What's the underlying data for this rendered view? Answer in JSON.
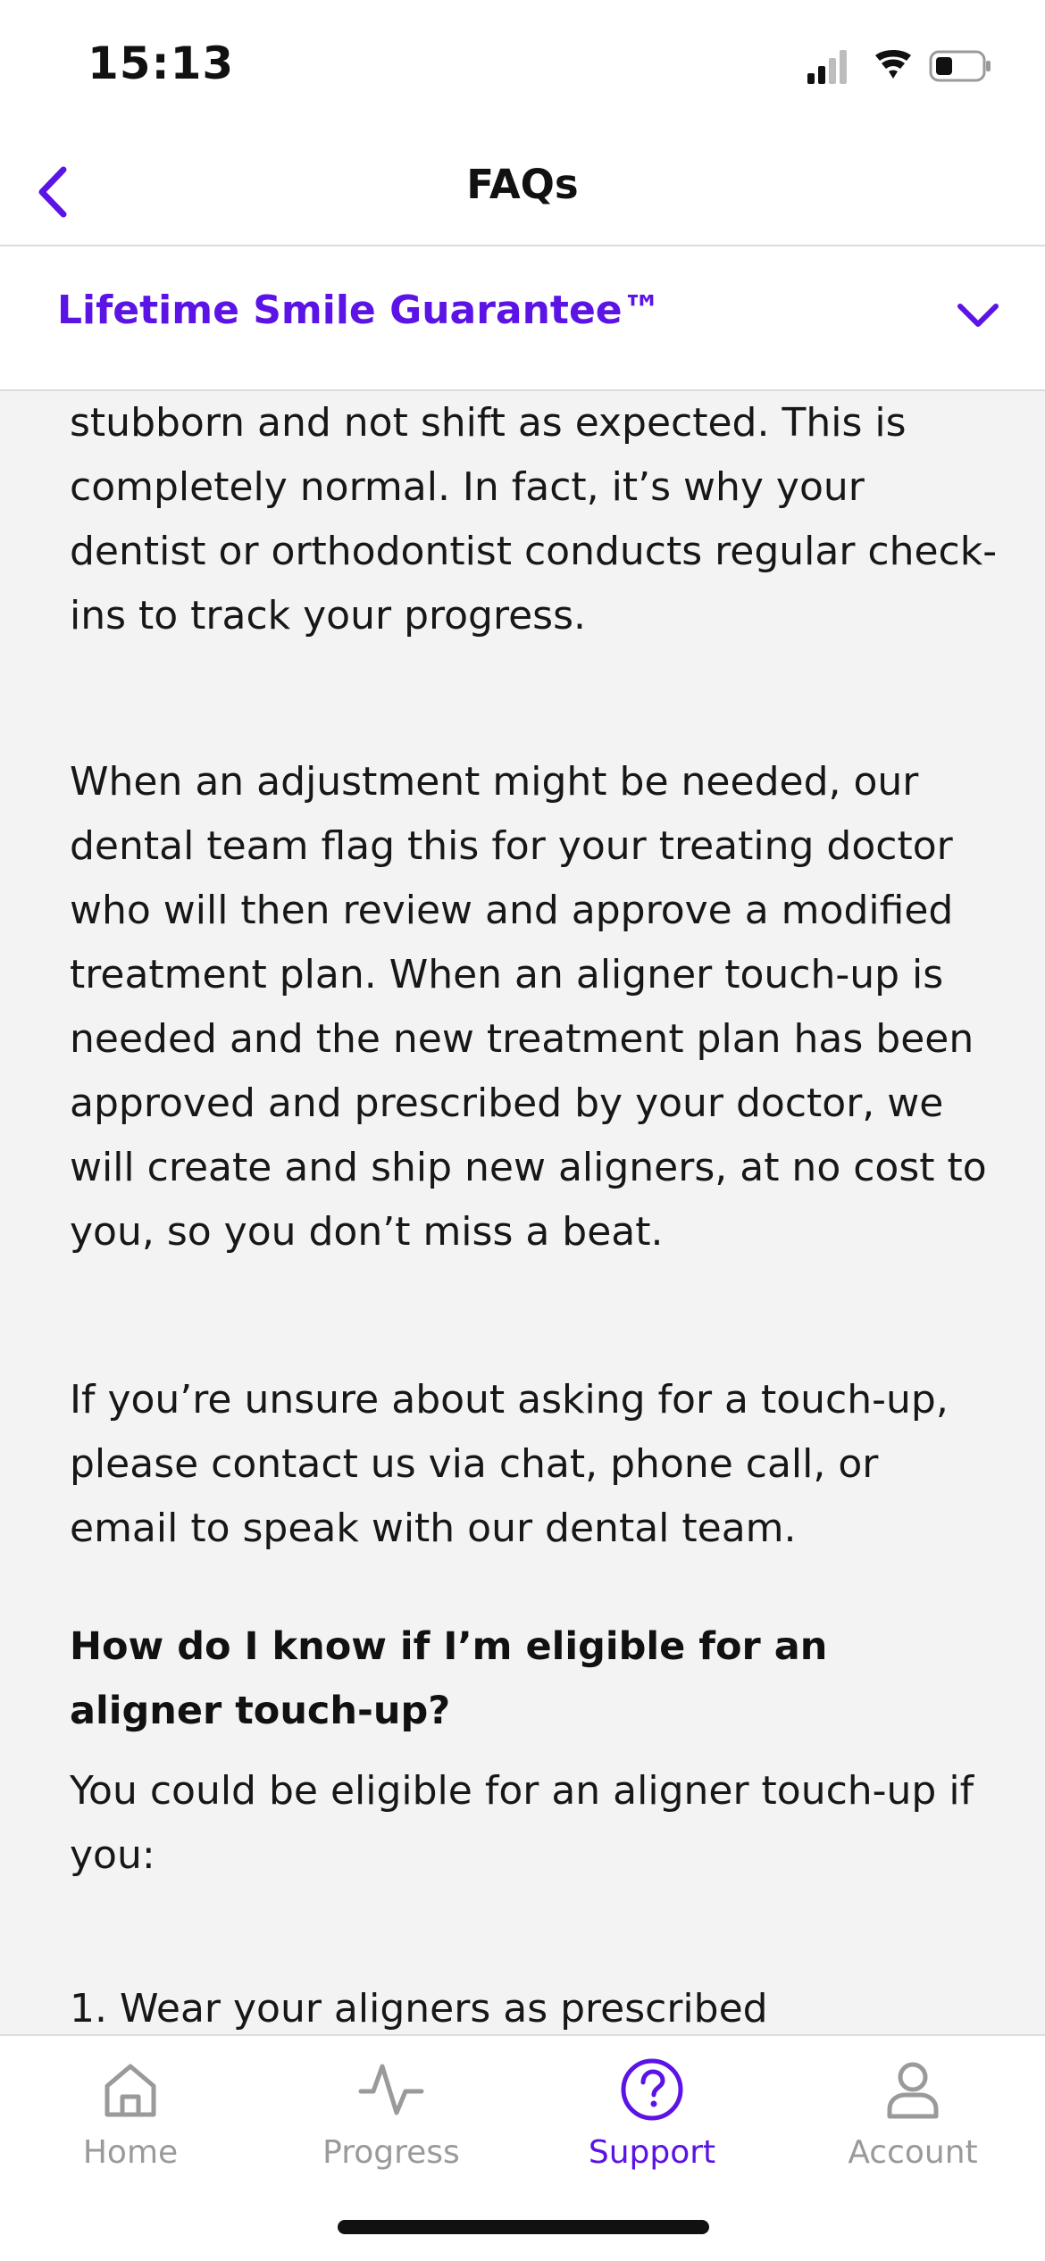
{
  "status_bar": {
    "time": "15:13",
    "icons": [
      "cellular-signal-icon",
      "wifi-icon",
      "battery-icon"
    ]
  },
  "nav": {
    "title": "FAQs",
    "back_icon": "chevron-left-icon"
  },
  "section": {
    "title": "Lifetime Smile Guarantee™",
    "expand_icon": "chevron-down-icon",
    "expanded": true
  },
  "content": {
    "paragraph_1": "stubborn and not shift as expected. This is completely normal. In fact, it’s why your dentist or orthodontist conducts regular check-ins to track your progress.",
    "paragraph_2": "When an adjustment might be needed, our dental team flag this for your treating doctor who will then review and approve a modified treatment plan. When an aligner touch-up is needed and the new treatment plan has been approved and prescribed by your doctor, we will create and ship new aligners, at no cost to you, so you don’t miss a beat.",
    "paragraph_3": "If you’re unsure about asking for a touch-up, please contact us via chat, phone call, or email to speak with our dental team.",
    "question": "How do I know if I’m eligible for an aligner touch-up?",
    "paragraph_4": "You could be eligible for an aligner touch-up if you:",
    "list_item_1": "1. Wear your aligners as prescribed"
  },
  "tabs": [
    {
      "label": "Home",
      "icon": "home-icon",
      "active": false
    },
    {
      "label": "Progress",
      "icon": "activity-icon",
      "active": false
    },
    {
      "label": "Support",
      "icon": "help-circle-icon",
      "active": true
    },
    {
      "label": "Account",
      "icon": "user-icon",
      "active": false
    }
  ],
  "colors": {
    "accent": "#5b13e6",
    "inactive": "#9a9a9a",
    "background": "#f3f3f3",
    "text": "#171717"
  }
}
